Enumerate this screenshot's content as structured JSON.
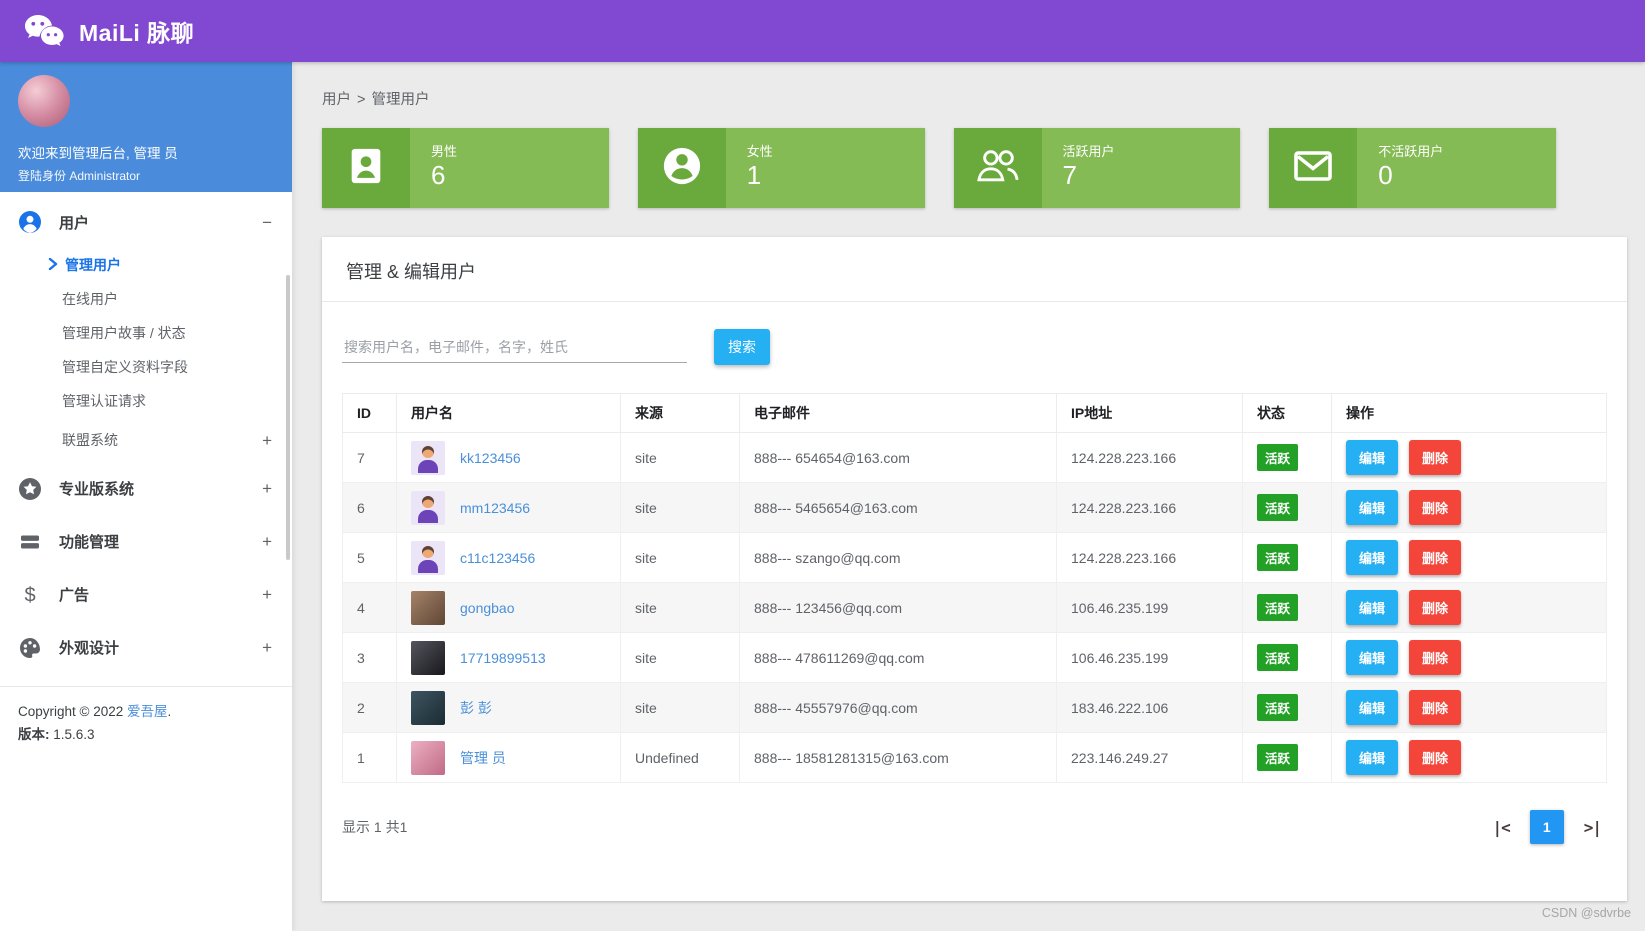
{
  "header": {
    "brand": "MaiLi 脉聊",
    "logo_icon": "wechat-icon"
  },
  "sidebar": {
    "welcome_line1": "欢迎来到管理后台, 管理 员",
    "welcome_line2": "登陆身份 Administrator",
    "menu": [
      {
        "key": "users",
        "label": "用户",
        "icon": "user-icon",
        "toggle": "−",
        "children": [
          {
            "key": "manage-users",
            "label": "管理用户",
            "active": true
          },
          {
            "key": "online-users",
            "label": "在线用户"
          },
          {
            "key": "user-stories",
            "label": "管理用户故事 / 状态"
          },
          {
            "key": "custom-fields",
            "label": "管理自定义资料字段"
          },
          {
            "key": "verification-requests",
            "label": "管理认证请求"
          },
          {
            "key": "affiliate-system",
            "label": "联盟系统",
            "toggle": "+"
          }
        ]
      },
      {
        "key": "pro-system",
        "label": "专业版系统",
        "icon": "star-icon",
        "toggle": "+"
      },
      {
        "key": "feature-management",
        "label": "功能管理",
        "icon": "features-icon",
        "toggle": "+"
      },
      {
        "key": "ads",
        "label": "广告",
        "icon": "dollar-icon",
        "toggle": "+"
      },
      {
        "key": "appearance",
        "label": "外观设计",
        "icon": "palette-icon",
        "toggle": "+"
      }
    ],
    "copyright_prefix": "Copyright © 2022 ",
    "copyright_link": "爱吾屋",
    "copyright_suffix": ".",
    "version_label": "版本:",
    "version_value": " 1.5.6.3"
  },
  "breadcrumb": {
    "section": "用户",
    "separator": ">",
    "page": "管理用户"
  },
  "stat_cards": [
    {
      "key": "male",
      "label": "男性",
      "value": "6",
      "icon": "male-badge-icon"
    },
    {
      "key": "female",
      "label": "女性",
      "value": "1",
      "icon": "female-circle-icon"
    },
    {
      "key": "active-users",
      "label": "活跃用户",
      "value": "7",
      "icon": "active-users-icon"
    },
    {
      "key": "inactive-users",
      "label": "不活跃用户",
      "value": "0",
      "icon": "inactive-mail-icon"
    }
  ],
  "panel": {
    "title": "管理 & 编辑用户",
    "search_placeholder": "搜索用户名，电子邮件，名字，姓氏",
    "search_button": "搜索",
    "table": {
      "columns": [
        "ID",
        "用户名",
        "来源",
        "电子邮件",
        "IP地址",
        "状态",
        "操作"
      ],
      "actions": {
        "edit": "编辑",
        "delete": "删除"
      },
      "rows": [
        {
          "id": "7",
          "username": "kk123456",
          "avatar": "cartoon",
          "avatar_colors": [],
          "source": "site",
          "email": "888--- 654654@163.com",
          "ip": "124.228.223.166",
          "status": "活跃"
        },
        {
          "id": "6",
          "username": "mm123456",
          "avatar": "cartoon",
          "avatar_colors": [],
          "source": "site",
          "email": "888--- 5465654@163.com",
          "ip": "124.228.223.166",
          "status": "活跃"
        },
        {
          "id": "5",
          "username": "c11c123456",
          "avatar": "cartoon",
          "avatar_colors": [],
          "source": "site",
          "email": "888--- szango@qq.com",
          "ip": "124.228.223.166",
          "status": "活跃"
        },
        {
          "id": "4",
          "username": "gongbao",
          "avatar": "photo",
          "avatar_colors": [
            "#a5836a",
            "#5f4634"
          ],
          "source": "site",
          "email": "888--- 123456@qq.com",
          "ip": "106.46.235.199",
          "status": "活跃"
        },
        {
          "id": "3",
          "username": "17719899513",
          "avatar": "photo",
          "avatar_colors": [
            "#55555e",
            "#17171c"
          ],
          "source": "site",
          "email": "888--- 478611269@qq.com",
          "ip": "106.46.235.199",
          "status": "活跃"
        },
        {
          "id": "2",
          "username": "彭 彭",
          "avatar": "photo",
          "avatar_colors": [
            "#3d5560",
            "#1b2b33"
          ],
          "source": "site",
          "email": "888--- 45557976@qq.com",
          "ip": "183.46.222.106",
          "status": "活跃"
        },
        {
          "id": "1",
          "username": "管理 员",
          "avatar": "photo",
          "avatar_colors": [
            "#ecb0c2",
            "#c06a86"
          ],
          "source": "Undefined",
          "email": "888--- 18581281315@163.com",
          "ip": "223.146.249.27",
          "status": "活跃"
        }
      ]
    },
    "footer": {
      "summary": "显示 1 共1",
      "pagination": {
        "first_label": "|<",
        "active_page": "1",
        "last_label": ">|"
      }
    }
  },
  "watermark": "CSDN @sdvrbe",
  "colors": {
    "header_purple": "#8148d2",
    "profile_blue": "#4a8cdb",
    "card_green_light": "#84bb55",
    "card_green_dark": "#6aaa3c",
    "status_green": "#23a127",
    "edit_blue": "#24b0f2",
    "delete_red": "#f3453a",
    "link_blue": "#4a90d9",
    "active_menu_blue": "#1a73e8",
    "pagination_blue": "#2196f3"
  }
}
